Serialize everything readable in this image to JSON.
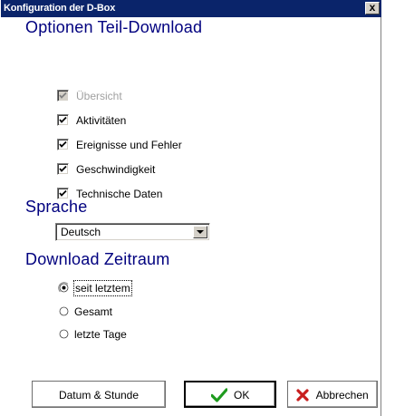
{
  "window": {
    "title": "Konfiguration der D-Box",
    "close_label": "x"
  },
  "partial_download": {
    "heading": "Optionen Teil-Download",
    "options": [
      {
        "label": "Übersicht",
        "checked": true,
        "disabled": true
      },
      {
        "label": "Aktivitäten",
        "checked": true,
        "disabled": false
      },
      {
        "label": "Ereignisse und Fehler",
        "checked": true,
        "disabled": false
      },
      {
        "label": "Geschwindigkeit",
        "checked": true,
        "disabled": false
      },
      {
        "label": "Technische Daten",
        "checked": true,
        "disabled": false
      }
    ]
  },
  "language": {
    "heading": "Sprache",
    "selected": "Deutsch"
  },
  "download_period": {
    "heading": "Download Zeitraum",
    "options": [
      {
        "label": "seit letztem",
        "selected": true
      },
      {
        "label": "Gesamt",
        "selected": false
      },
      {
        "label": "letzte Tage",
        "selected": false
      }
    ]
  },
  "buttons": {
    "datetime_label": "Datum & Stunde",
    "ok_label": "OK",
    "cancel_label": "Abbrechen"
  },
  "colors": {
    "heading": "#00007f",
    "titlebar": "#0a246a",
    "ok_check": "#1e9b1e",
    "cancel_x": "#c81e1e"
  }
}
